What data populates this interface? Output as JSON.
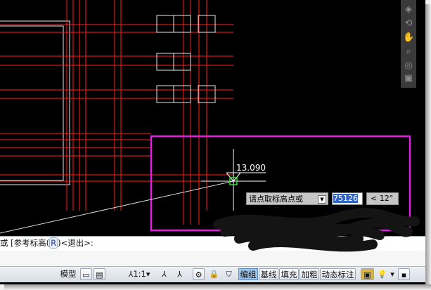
{
  "canvas": {
    "elevation_label": "13.090",
    "background": "#000000",
    "grid_line_color": "#ff2020",
    "selection_frame_color": "#e020e0"
  },
  "dynamic_input": {
    "prompt": "请点取标高点或",
    "value": "75126",
    "angle": "< 12°"
  },
  "command_line": {
    "prefix": "或",
    "option_open": "[参考标高(",
    "option_key": "R",
    "option_close": ")<退出>:"
  },
  "status_bar": {
    "model_label": "模型",
    "scale_label": "1:1",
    "tools": [
      "编组",
      "基线",
      "填充",
      "加粗",
      "动态标注"
    ]
  },
  "nav_bar": {
    "icons": [
      "cube-icon",
      "orbit-icon",
      "pan-icon",
      "zoom-icon",
      "steering-wheel-icon",
      "showmotion-icon"
    ]
  }
}
